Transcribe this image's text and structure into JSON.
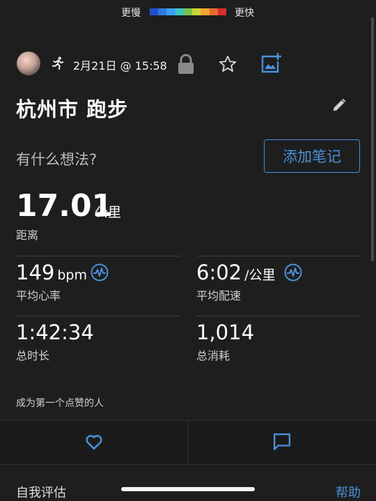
{
  "pace_legend": {
    "slower": "更慢",
    "faster": "更快",
    "colors": [
      "#1f4fd1",
      "#2f7be0",
      "#3aa0f0",
      "#3cc6c0",
      "#79c24a",
      "#c9d43a",
      "#f0a431",
      "#ef6a2a",
      "#d62e2e"
    ]
  },
  "activity": {
    "date": "2月21日 @ 15:58",
    "title": "杭州市 跑步",
    "thoughts_prompt": "有什么想法?",
    "add_note_label": "添加笔记"
  },
  "distance": {
    "value": "17.01",
    "unit": "公里",
    "label": "距离"
  },
  "stats": {
    "hr": {
      "value": "149",
      "unit": "bpm",
      "label": "平均心率"
    },
    "pace": {
      "value": "6:02",
      "unit": "/公里",
      "label": "平均配速"
    },
    "duration": {
      "value": "1:42:34",
      "label": "总时长"
    },
    "calories": {
      "value": "1,014",
      "label": "总消耗"
    }
  },
  "social": {
    "first_like": "成为第一个点赞的人"
  },
  "footer": {
    "self_eval": "自我评估",
    "help": "帮助"
  },
  "colors": {
    "accent": "#4a90d9",
    "background": "#1e1e1e"
  },
  "icons": [
    "avatar",
    "running-icon",
    "lock-icon",
    "star-icon",
    "add-photo-icon",
    "pencil-icon",
    "heart-rate-icon",
    "heart-icon",
    "comment-icon"
  ]
}
